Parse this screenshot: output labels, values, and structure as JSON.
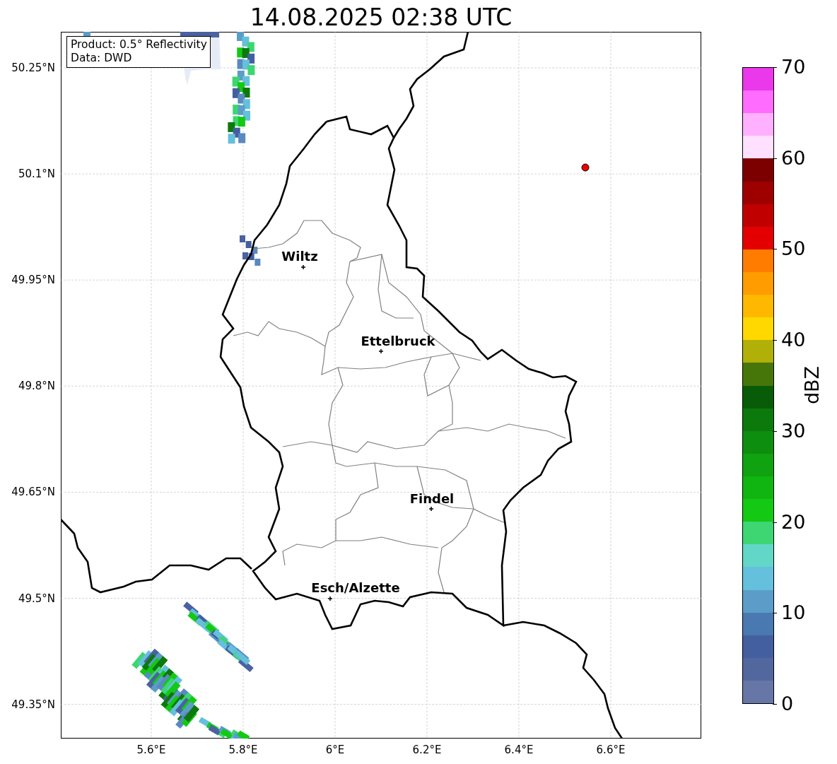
{
  "title": "14.08.2025 02:38 UTC",
  "legend": [
    "Product: 0.5° Reflectivity",
    "Data: DWD"
  ],
  "y_ticks": [
    "50.25°N",
    "50.1°N",
    "49.95°N",
    "49.8°N",
    "49.65°N",
    "49.5°N",
    "49.35°N"
  ],
  "x_ticks": [
    "5.6°E",
    "5.8°E",
    "6°E",
    "6.2°E",
    "6.4°E",
    "6.6°E"
  ],
  "cities": [
    "Wiltz",
    "Ettelbruck",
    "Findel",
    "Esch/Alzette"
  ],
  "colorbar": {
    "label": "dBZ",
    "ticks": [
      "70",
      "60",
      "50",
      "40",
      "30",
      "20",
      "10",
      "0"
    ],
    "bins": [
      {
        "color": "#ea38ea"
      },
      {
        "color": "#ff6cff"
      },
      {
        "color": "#ffb0ff"
      },
      {
        "color": "#ffe0ff"
      },
      {
        "color": "#7c0000"
      },
      {
        "color": "#9e0000"
      },
      {
        "color": "#c00000"
      },
      {
        "color": "#e40000"
      },
      {
        "color": "#ff7c00"
      },
      {
        "color": "#ff9c00"
      },
      {
        "color": "#ffb800"
      },
      {
        "color": "#ffd800"
      },
      {
        "color": "#b0b008"
      },
      {
        "color": "#467609"
      },
      {
        "color": "#085c08"
      },
      {
        "color": "#0c790c"
      },
      {
        "color": "#0e8e0e"
      },
      {
        "color": "#10a210"
      },
      {
        "color": "#11b511"
      },
      {
        "color": "#13c913"
      },
      {
        "color": "#3dd672"
      },
      {
        "color": "#62d7c8"
      },
      {
        "color": "#64c0dc"
      },
      {
        "color": "#5b9dc8"
      },
      {
        "color": "#4a78b0"
      },
      {
        "color": "#445f9f"
      },
      {
        "color": "#53679f"
      },
      {
        "color": "#6677a7"
      }
    ]
  }
}
